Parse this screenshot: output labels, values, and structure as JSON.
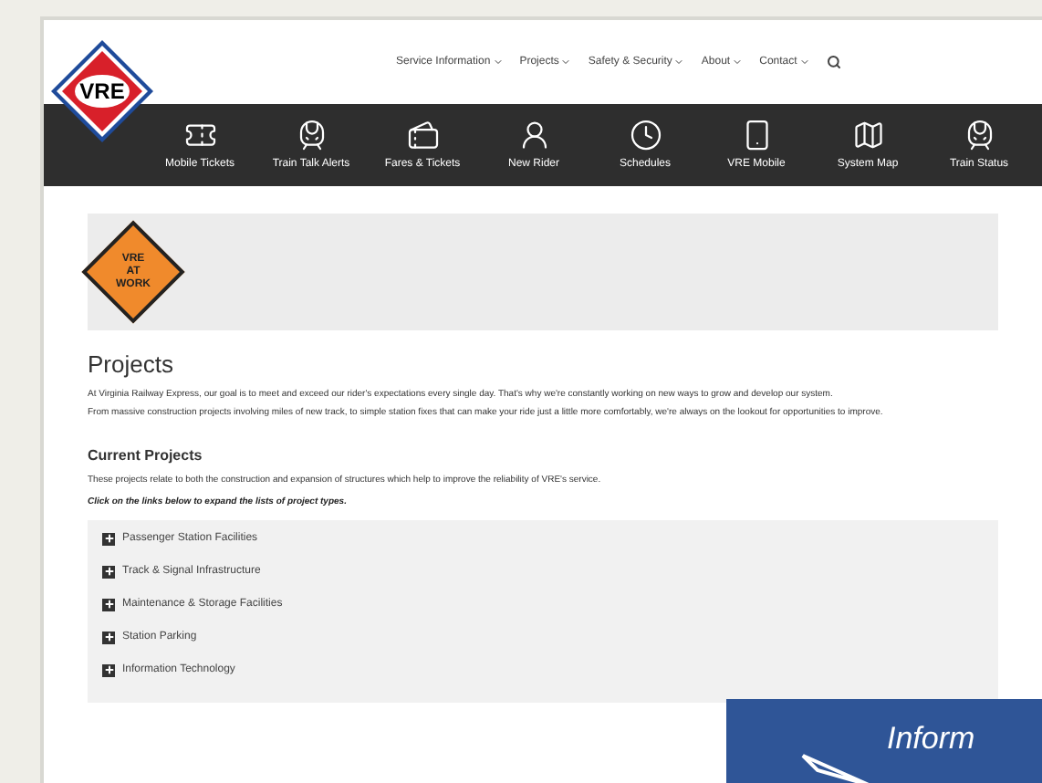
{
  "logo": {
    "text": "VRE"
  },
  "top_nav": [
    {
      "label": "Service Information",
      "has_menu": true
    },
    {
      "label": "Projects",
      "has_menu": true
    },
    {
      "label": "Safety & Security",
      "has_menu": true
    },
    {
      "label": "About",
      "has_menu": true
    },
    {
      "label": "Contact",
      "has_menu": true
    }
  ],
  "quick_links": [
    {
      "label": "Mobile Tickets",
      "kind": "ticket"
    },
    {
      "label": "Train Talk Alerts",
      "kind": "train"
    },
    {
      "label": "Fares & Tickets",
      "kind": "tickets"
    },
    {
      "label": "New Rider",
      "kind": "person"
    },
    {
      "label": "Schedules",
      "kind": "clock"
    },
    {
      "label": "VRE Mobile",
      "kind": "phone"
    },
    {
      "label": "System Map",
      "kind": "map"
    },
    {
      "label": "Train Status",
      "kind": "status"
    }
  ],
  "hero": {
    "sign_lines": [
      "VRE",
      "AT",
      "WORK"
    ]
  },
  "title": "Projects",
  "intro": [
    "At Virginia Railway Express, our goal is to meet and exceed our rider's expectations every single day. That's why we're constantly working on new ways to grow and develop our system.",
    "From massive construction projects involving miles of new track, to simple station fixes that can make your ride just a little more comfortably, we're always on the lookout for opportunities to improve."
  ],
  "current": {
    "heading": "Current Projects",
    "description": "These projects relate to both the construction and expansion of structures which help to improve the reliability of VRE's service.",
    "hint": "Click on the links below to expand the lists of project types."
  },
  "project_types": [
    {
      "label": "Passenger Station Facilities",
      "expanded": false
    },
    {
      "label": "Track & Signal Infrastructure",
      "expanded": false
    },
    {
      "label": "Maintenance & Storage Facilities",
      "expanded": false
    },
    {
      "label": "Station Parking",
      "expanded": false
    },
    {
      "label": "Information Technology",
      "expanded": false
    }
  ],
  "banner": {
    "text": "Inform"
  }
}
